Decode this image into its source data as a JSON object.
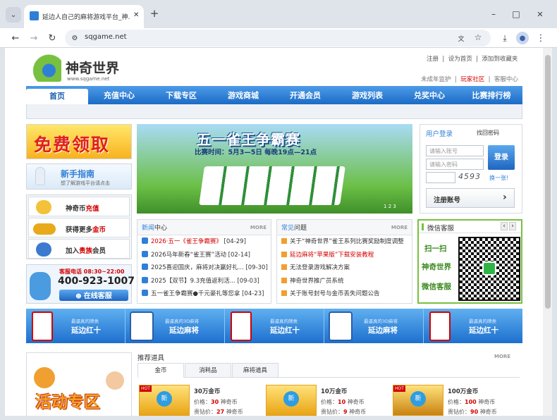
{
  "browser": {
    "tab_title": "延边人自己的麻将游戏平台_神...",
    "url": "sqgame.net",
    "new_tab": "+",
    "minimize": "–",
    "maximize": "□",
    "close": "✕"
  },
  "site": {
    "logo_text": "神奇世界",
    "logo_domain": "www.sqgame.net",
    "top_links": [
      "注册",
      "设为首页",
      "添加到收藏夹"
    ],
    "sub_links": [
      "未成年监护",
      "玩家社区",
      "客服中心"
    ],
    "nav": [
      "首页",
      "充值中心",
      "下载专区",
      "游戏商城",
      "开通会员",
      "游戏列表",
      "兑奖中心",
      "比赛排行榜"
    ]
  },
  "left": {
    "free_banner": "免费领取",
    "guide_title": "新手指南",
    "guide_sub": "想了解游戏平台请点击",
    "shortcuts": [
      {
        "a": "神奇币",
        "b": "充值"
      },
      {
        "a": "获得更多",
        "b": "金币"
      },
      {
        "a": "加入",
        "b": "贵族",
        "c": "会员"
      }
    ],
    "hotline_label": "客服电话 08:30~22:00",
    "hotline": "400-923-1007",
    "online": "在线客服"
  },
  "banner": {
    "title": "五一雀王争霸赛",
    "time": "比赛时间：5月3—5日 每晚19点—21点",
    "pages": [
      "1",
      "2",
      "3"
    ]
  },
  "login": {
    "tab1": "用户登录",
    "tab2": "找回密码",
    "user_ph": "请输入账号",
    "pass_ph": "请输入密码",
    "login_btn": "登录",
    "captcha": "4593",
    "refresh": "换一张!",
    "register": "注册账号",
    "arrow": "›"
  },
  "news": {
    "title_a": "新闻",
    "title_b": "中心",
    "more": "MORE",
    "items": [
      {
        "pre": "2026·五一",
        "hl": "《雀王争霸赛》",
        "post": " [04-29]"
      },
      {
        "pre": "2026马年新春“雀王赛”活动 [02-14]"
      },
      {
        "pre": "2025喜迎国庆，麻将对决赢好礼... [09-30]"
      },
      {
        "pre": "2025【双节】9.3充值返利活... [09-03]"
      },
      {
        "pre": "五一雀王争霸赛●千元豪礼等您拿 [04-23]"
      }
    ]
  },
  "faq": {
    "title_a": "常见",
    "title_b": "问题",
    "more": "MORE",
    "items": [
      "关于“神奇世界”雀王系列比赛奖励制度调整",
      "延边麻将“苹果版”下载安装教程",
      "无法登录游戏解决方案",
      "神奇世界推广员系统",
      "关于账号封号与金币丢失问题公告"
    ]
  },
  "wechat": {
    "title": "微信客服",
    "lines": [
      "扫一扫",
      "神奇世界",
      "微信客服"
    ],
    "prev": "‹",
    "next": "›"
  },
  "strip": {
    "items": [
      {
        "t": "最逼真的牌类",
        "n": "延边红十"
      },
      {
        "t": "最逼真的3D麻将",
        "n": "延边麻将"
      },
      {
        "t": "最逼真的牌类",
        "n": "延边红十"
      },
      {
        "t": "最逼真的3D麻将",
        "n": "延边麻将"
      },
      {
        "t": "最逼真的牌类",
        "n": "延边红十"
      }
    ]
  },
  "activity": "活动专区",
  "props": {
    "title": "推荐道具",
    "more": "MORE",
    "tabs": [
      "金币",
      "消耗品",
      "麻将道具"
    ],
    "items": [
      {
        "name": "30万金币",
        "price_l": "价格：",
        "price": "30",
        "unit": "神奇币",
        "vip_l": "贵钻价：",
        "vip": "27",
        "vunit": "神奇币"
      },
      {
        "name": "10万金币",
        "price_l": "价格：",
        "price": "10",
        "unit": "神奇币",
        "vip_l": "贵钻价：",
        "vip": "9",
        "vunit": "神奇币"
      },
      {
        "name": "100万金币",
        "price_l": "价格：",
        "price": "100",
        "unit": "神奇币",
        "vip_l": "贵钻价：",
        "vip": "90",
        "vunit": "神奇币"
      }
    ],
    "badge": "HOT",
    "new": "新"
  },
  "colors": {
    "nav": "#1c6bc6",
    "accent": "#d40000",
    "green": "#78c040"
  }
}
